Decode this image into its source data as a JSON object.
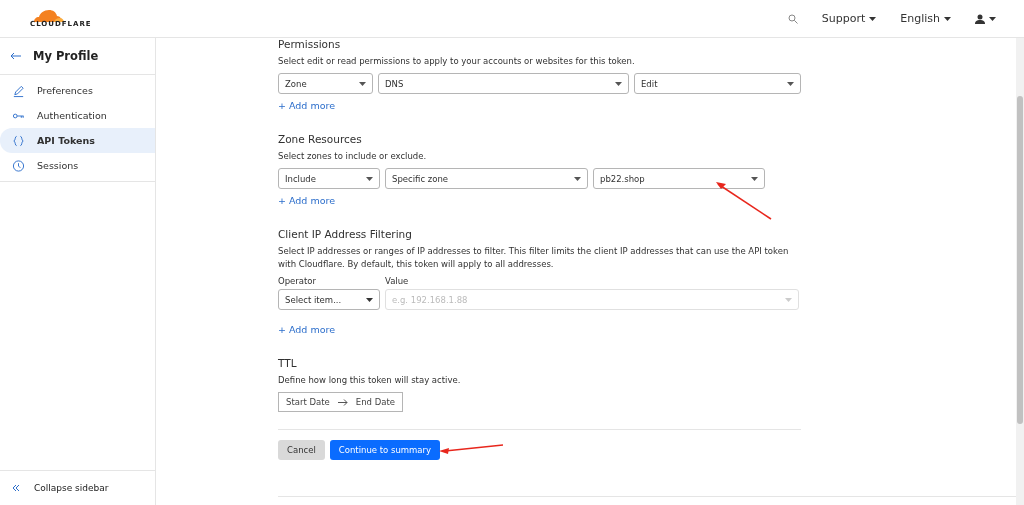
{
  "header": {
    "logo": "CLOUDFLARE",
    "menus": [
      {
        "label": "Support",
        "kind": "text"
      },
      {
        "label": "English",
        "kind": "text"
      },
      {
        "kind": "user"
      }
    ]
  },
  "sidebar": {
    "title": "My Profile",
    "items": [
      {
        "label": "Preferences",
        "selected": false
      },
      {
        "label": "Authentication",
        "selected": false
      },
      {
        "label": "API Tokens",
        "selected": true
      },
      {
        "label": "Sessions",
        "selected": false
      }
    ],
    "collapse": "Collapse sidebar"
  },
  "sections": [
    {
      "kind": "selects",
      "title": "Permissions",
      "description": "Select edit or read permissions to apply to your accounts or websites for this token.",
      "selects": [
        {
          "value": "Zone"
        },
        {
          "value": "DNS"
        },
        {
          "value": "Edit"
        }
      ],
      "add_more": "+ Add more"
    },
    {
      "kind": "selects",
      "title": "Zone Resources",
      "description": "Select zones to include or exclude.",
      "selects": [
        {
          "value": "Include"
        },
        {
          "value": "Specific zone"
        },
        {
          "value": "pb22.shop"
        }
      ],
      "add_more": "+ Add more"
    },
    {
      "kind": "filter",
      "title": "Client IP Address Filtering",
      "description": "Select IP addresses or ranges of IP addresses to filter. This filter limits the client IP addresses that can use the API token with Cloudflare. By default, this token will apply to all addresses.",
      "operator_label": "Operator",
      "value_label": "Value",
      "operator": {
        "value": "Select item..."
      },
      "value": {
        "placeholder": "e.g. 192.168.1.88",
        "disabled": true
      },
      "add_more": "+ Add more"
    },
    {
      "kind": "dates",
      "title": "TTL",
      "description": "Define how long this token will stay active.",
      "start": "Start Date",
      "end": "End Date"
    }
  ],
  "actions": {
    "cancel": "Cancel",
    "continue": "Continue to summary"
  }
}
